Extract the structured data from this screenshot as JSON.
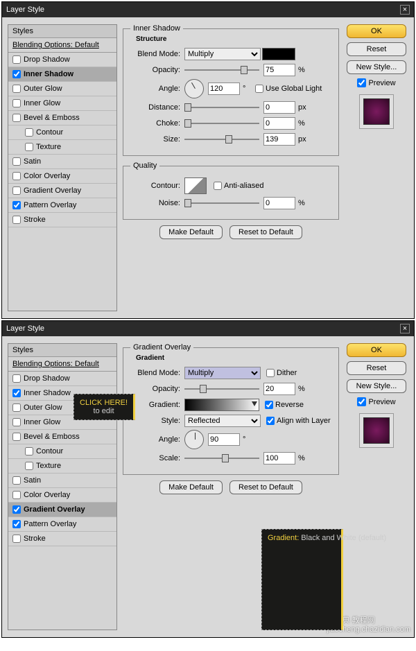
{
  "dialogs": [
    {
      "title": "Layer Style",
      "stylesHeader": "Styles",
      "blendingOptions": "Blending Options: Default",
      "items": [
        {
          "label": "Drop Shadow",
          "checked": false,
          "selected": false
        },
        {
          "label": "Inner Shadow",
          "checked": true,
          "selected": true
        },
        {
          "label": "Outer Glow",
          "checked": false,
          "selected": false
        },
        {
          "label": "Inner Glow",
          "checked": false,
          "selected": false
        },
        {
          "label": "Bevel & Emboss",
          "checked": false,
          "selected": false
        },
        {
          "label": "Contour",
          "checked": false,
          "selected": false,
          "indent": true
        },
        {
          "label": "Texture",
          "checked": false,
          "selected": false,
          "indent": true
        },
        {
          "label": "Satin",
          "checked": false,
          "selected": false
        },
        {
          "label": "Color Overlay",
          "checked": false,
          "selected": false
        },
        {
          "label": "Gradient Overlay",
          "checked": false,
          "selected": false
        },
        {
          "label": "Pattern Overlay",
          "checked": true,
          "selected": false
        },
        {
          "label": "Stroke",
          "checked": false,
          "selected": false
        }
      ],
      "fieldsetTitle": "Inner Shadow",
      "structure": {
        "legend": "Structure",
        "blendModeLabel": "Blend Mode:",
        "blendMode": "Multiply",
        "opacityLabel": "Opacity:",
        "opacity": "75",
        "opacityUnit": "%",
        "angleLabel": "Angle:",
        "angle": "120",
        "angleUnit": "°",
        "useGlobal": "Use Global Light",
        "distanceLabel": "Distance:",
        "distance": "0",
        "distanceUnit": "px",
        "chokeLabel": "Choke:",
        "choke": "0",
        "chokeUnit": "%",
        "sizeLabel": "Size:",
        "size": "139",
        "sizeUnit": "px"
      },
      "quality": {
        "legend": "Quality",
        "contourLabel": "Contour:",
        "antiAliased": "Anti-aliased",
        "noiseLabel": "Noise:",
        "noise": "0",
        "noiseUnit": "%"
      },
      "makeDefault": "Make Default",
      "resetDefault": "Reset to Default",
      "buttons": {
        "ok": "OK",
        "reset": "Reset",
        "newStyle": "New Style...",
        "preview": "Preview"
      }
    },
    {
      "title": "Layer Style",
      "stylesHeader": "Styles",
      "blendingOptions": "Blending Options: Default",
      "items": [
        {
          "label": "Drop Shadow",
          "checked": false,
          "selected": false
        },
        {
          "label": "Inner Shadow",
          "checked": true,
          "selected": false
        },
        {
          "label": "Outer Glow",
          "checked": false,
          "selected": false
        },
        {
          "label": "Inner Glow",
          "checked": false,
          "selected": false
        },
        {
          "label": "Bevel & Emboss",
          "checked": false,
          "selected": false
        },
        {
          "label": "Contour",
          "checked": false,
          "selected": false,
          "indent": true
        },
        {
          "label": "Texture",
          "checked": false,
          "selected": false,
          "indent": true
        },
        {
          "label": "Satin",
          "checked": false,
          "selected": false
        },
        {
          "label": "Color Overlay",
          "checked": false,
          "selected": false
        },
        {
          "label": "Gradient Overlay",
          "checked": true,
          "selected": true
        },
        {
          "label": "Pattern Overlay",
          "checked": true,
          "selected": false
        },
        {
          "label": "Stroke",
          "checked": false,
          "selected": false
        }
      ],
      "fieldsetTitle": "Gradient Overlay",
      "gradient": {
        "legend": "Gradient",
        "blendModeLabel": "Blend Mode:",
        "blendMode": "Multiply",
        "dither": "Dither",
        "opacityLabel": "Opacity:",
        "opacity": "20",
        "opacityUnit": "%",
        "gradientLabel": "Gradient:",
        "reverse": "Reverse",
        "styleLabel": "Style:",
        "style": "Reflected",
        "align": "Align with Layer",
        "angleLabel": "Angle:",
        "angle": "90",
        "angleUnit": "°",
        "scaleLabel": "Scale:",
        "scale": "100",
        "scaleUnit": "%"
      },
      "makeDefault": "Make Default",
      "resetDefault": "Reset to Default",
      "buttons": {
        "ok": "OK",
        "reset": "Reset",
        "newStyle": "New Style...",
        "preview": "Preview"
      },
      "tooltipClick1": "CLICK HERE!",
      "tooltipClick2": "to edit",
      "gradNoteLabel": "Gradient:",
      "gradNoteValue": " Black and White (default)"
    }
  ],
  "watermark1": "查字典 教程网",
  "watermark2": "jiaocheng.chazidian.com"
}
